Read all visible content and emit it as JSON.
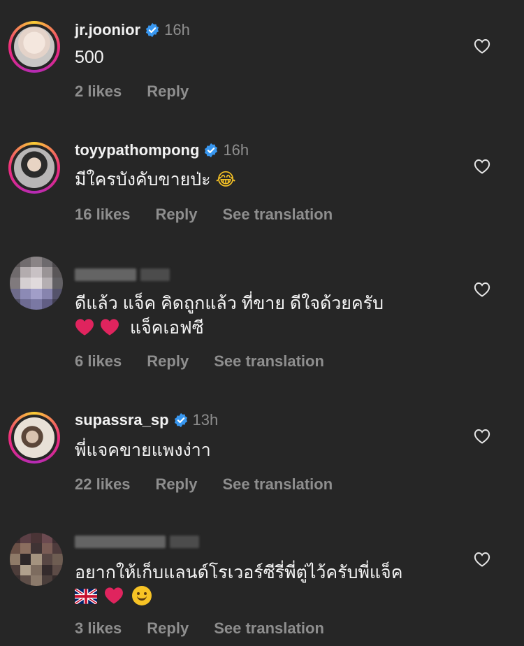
{
  "comments": [
    {
      "username": "jr.joonior",
      "time": "16h",
      "text": "500",
      "likes": "2 likes",
      "reply": "Reply",
      "translation": ""
    },
    {
      "username": "toyypathompong",
      "time": "16h",
      "text": "มีใครบังคับขายป่ะ",
      "emoji": "😂",
      "likes": "16 likes",
      "reply": "Reply",
      "translation": "See translation"
    },
    {
      "username": "",
      "time": "",
      "text": "ดีแล้ว  แจ็ค คิดถูกแล้ว ที่ขาย  ดีใจด้วยครับ",
      "text2": "แจ็คเอฟซี",
      "likes": "6 likes",
      "reply": "Reply",
      "translation": "See translation"
    },
    {
      "username": "supassra_sp",
      "time": "13h",
      "text": "พี่แจคขายแพงง่าา",
      "likes": "22 likes",
      "reply": "Reply",
      "translation": "See translation"
    },
    {
      "username": "",
      "time": "",
      "text": "อยากให้เก็บแลนด์โรเวอร์ซีรี่พี่ตู่ไว้ครับพี่แจ็ค",
      "likes": "3 likes",
      "reply": "Reply",
      "translation": "See translation"
    }
  ],
  "colors": {
    "background": "#262626",
    "verified": "#3897f0",
    "secondary_text": "#8e8e8e",
    "heart_emoji": "#e0245e"
  }
}
